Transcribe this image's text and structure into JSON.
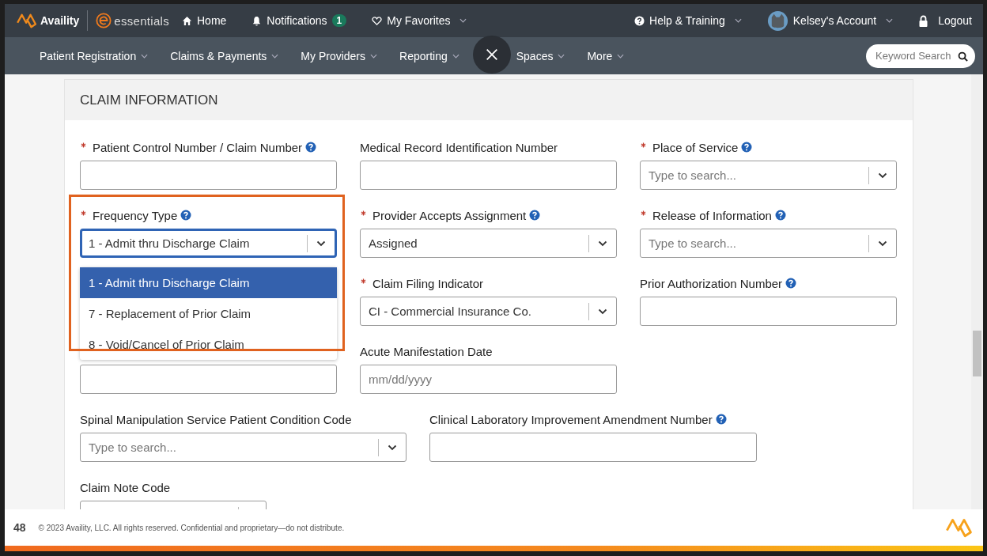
{
  "topbar": {
    "brand": "Availity",
    "product": "essentials",
    "nav": [
      {
        "kind": "home",
        "label": "Home"
      },
      {
        "kind": "bell",
        "label": "Notifications",
        "badge": "1"
      },
      {
        "kind": "heart",
        "label": "My Favorites",
        "caret": true
      }
    ],
    "right": [
      {
        "kind": "help",
        "label": "Help & Training",
        "caret": true
      },
      {
        "kind": "avatar",
        "label": "Kelsey's Account",
        "caret": true
      },
      {
        "kind": "lock",
        "label": "Logout",
        "caret": false
      }
    ]
  },
  "menubar": {
    "items": [
      "Patient Registration",
      "Claims & Payments",
      "My Providers",
      "Reporting",
      "Spaces",
      "More"
    ],
    "search": {
      "placeholder": "Keyword Search"
    }
  },
  "section": {
    "title": "CLAIM INFORMATION",
    "rows": [
      {
        "kind": "three",
        "fields": [
          {
            "kind": "text",
            "label": "Patient Control Number / Claim Number",
            "required": true,
            "help": true
          },
          {
            "kind": "text",
            "label": "Medical Record Identification Number",
            "required": false,
            "help": false
          },
          {
            "kind": "select",
            "label": "Place of Service",
            "required": true,
            "help": true,
            "placeholder": "Type to search..."
          }
        ]
      },
      {
        "kind": "three",
        "fields": [
          {
            "kind": "select",
            "label": "Frequency Type",
            "required": true,
            "help": true,
            "value": "1 - Admit thru Discharge Claim",
            "focused": true,
            "options": [
              {
                "label": "1 - Admit thru Discharge Claim",
                "selected": true
              },
              {
                "label": "7 - Replacement of Prior Claim",
                "selected": false
              },
              {
                "label": "8 - Void/Cancel of Prior Claim",
                "selected": false
              }
            ]
          },
          {
            "kind": "select",
            "label": "Provider Accepts Assignment",
            "required": true,
            "help": true,
            "value": "Assigned",
            "focused": false
          },
          {
            "kind": "select",
            "label": "Release of Information",
            "required": true,
            "help": true,
            "placeholder": "Type to search..."
          }
        ]
      },
      {
        "kind": "three",
        "fields": [
          {
            "kind": "covered"
          },
          {
            "kind": "select",
            "label": "Claim Filing Indicator",
            "required": true,
            "help": false,
            "value": "CI - Commercial Insurance Co.",
            "focused": false
          },
          {
            "kind": "text",
            "label": "Prior Authorization Number",
            "required": false,
            "help": true
          }
        ]
      },
      {
        "kind": "three",
        "fields": [
          {
            "kind": "text"
          },
          {
            "kind": "text",
            "label": "Acute Manifestation Date",
            "required": false,
            "help": false,
            "placeholder": "mm/dd/yyyy"
          }
        ]
      },
      {
        "kind": "two",
        "fields": [
          {
            "kind": "select",
            "label": "Spinal Manipulation Service Patient Condition Code",
            "required": false,
            "help": false,
            "placeholder": "Type to search..."
          },
          {
            "kind": "text",
            "label": "Clinical Laboratory Improvement Amendment Number",
            "required": false,
            "help": true
          }
        ]
      },
      {
        "kind": "short",
        "fields": [
          {
            "kind": "select",
            "label": "Claim Note Code",
            "required": false,
            "help": false
          }
        ]
      }
    ]
  },
  "footer": {
    "page": "48",
    "copyright": "© 2023 Availity, LLC. All rights reserved. Confidential and proprietary—do not distribute."
  }
}
